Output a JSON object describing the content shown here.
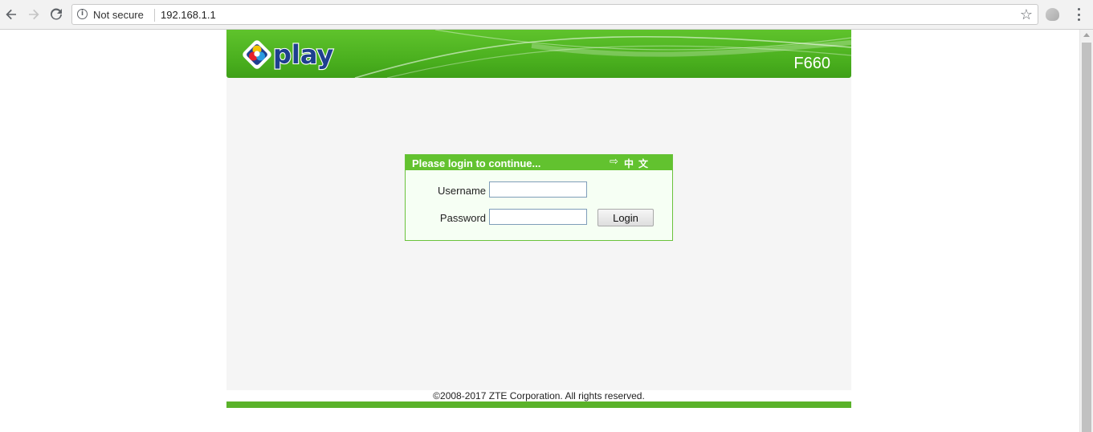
{
  "browser": {
    "security_label": "Not secure",
    "url": "192.168.1.1"
  },
  "header": {
    "logo_text": "play",
    "model": "F660"
  },
  "login": {
    "title": "Please login to continue...",
    "language_link": "中文",
    "username_label": "Username",
    "username_value": "",
    "password_label": "Password",
    "password_value": "",
    "login_button": "Login"
  },
  "footer": {
    "copyright": "©2008-2017 ZTE Corporation. All rights reserved."
  },
  "colors": {
    "brand_green": "#5ab22a",
    "header_green": "#62c22f",
    "logo_blue": "#1e3f8f"
  }
}
